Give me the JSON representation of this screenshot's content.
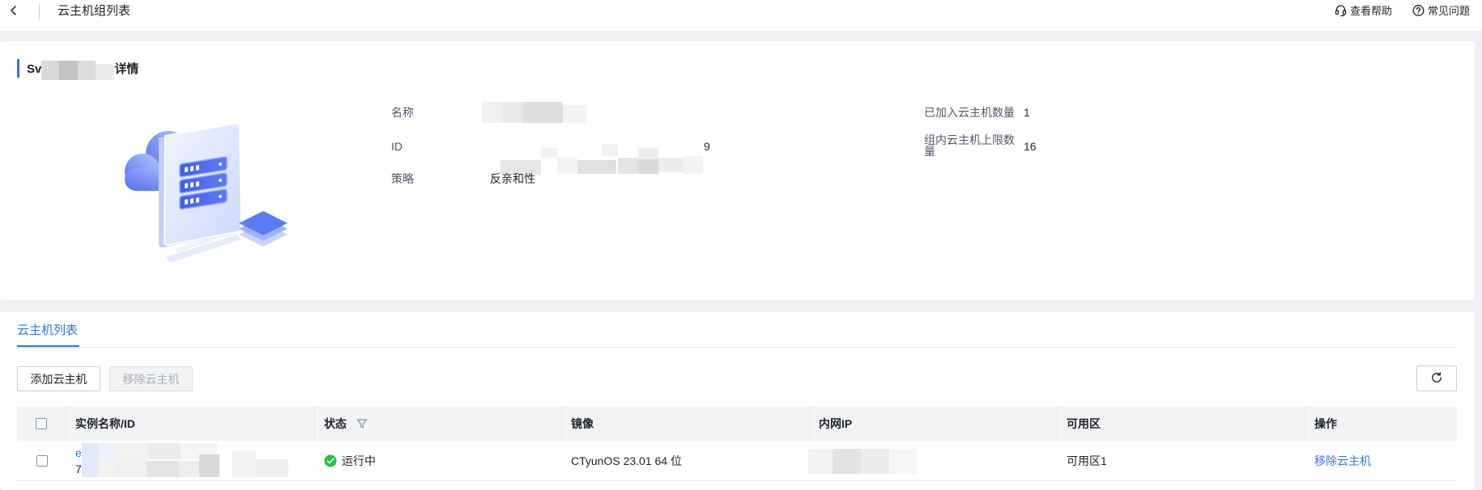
{
  "theme": {
    "accent": "#3370ff",
    "success": "#23c343"
  },
  "header": {
    "back_icon": "chevron-left-icon",
    "title": "云主机组列表",
    "help_icon": "headset-icon",
    "help_label": "查看帮助",
    "faq_icon": "question-circle-icon",
    "faq_label": "常见问题"
  },
  "detail": {
    "title_prefix": "Sv",
    "title_suffix": "详情",
    "fields_left": [
      {
        "label": "名称"
      },
      {
        "label": "ID",
        "value_tail": "9"
      },
      {
        "label": "策略",
        "value": "反亲和性"
      }
    ],
    "fields_right": [
      {
        "label": "已加入云主机数量",
        "value": "1"
      },
      {
        "label": "组内云主机上限数量",
        "value": "16"
      }
    ]
  },
  "vm_list": {
    "tab_label": "云主机列表",
    "add_button": "添加云主机",
    "remove_button": "移除云主机",
    "remove_button_disabled": true,
    "refresh_icon": "refresh-icon",
    "filter_icon": "filter-icon",
    "columns": [
      "实例名称/ID",
      "状态",
      "镜像",
      "内网IP",
      "可用区",
      "操作"
    ],
    "rows": [
      {
        "name_visible": "e",
        "id_visible": "7",
        "status": "运行中",
        "status_icon": "check-circle-icon",
        "image": "CTyunOS 23.01 64 位",
        "zone": "可用区1",
        "action": "移除云主机"
      }
    ]
  }
}
